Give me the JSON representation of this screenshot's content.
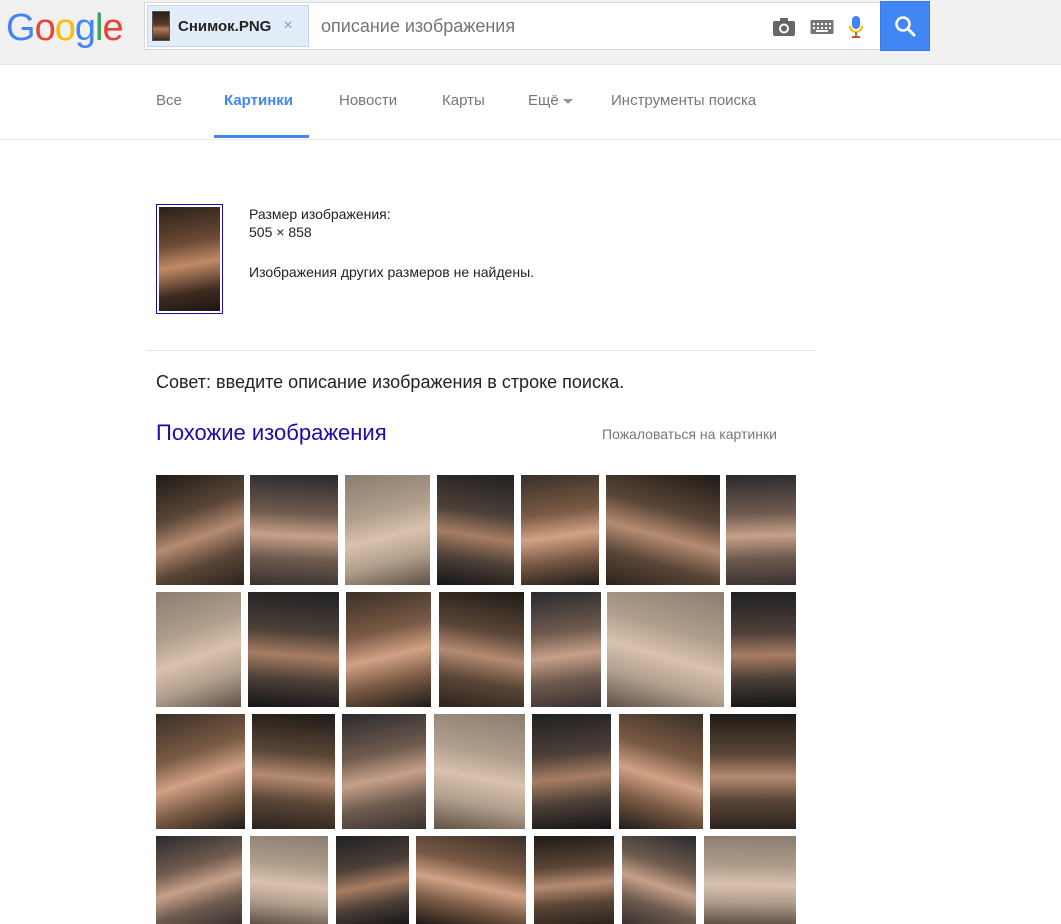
{
  "logo": {
    "letters": [
      "G",
      "o",
      "o",
      "g",
      "l",
      "e"
    ],
    "colors": [
      "#4285f4",
      "#ea4335",
      "#fbbc05",
      "#4285f4",
      "#34a853",
      "#ea4335"
    ]
  },
  "search": {
    "chip_label": "Снимок.PNG",
    "close_symbol": "×",
    "placeholder": "описание изображения"
  },
  "nav": {
    "items": [
      {
        "label": "Все"
      },
      {
        "label": "Картинки"
      },
      {
        "label": "Новости"
      },
      {
        "label": "Карты"
      },
      {
        "label": "Ещё"
      },
      {
        "label": "Инструменты поиска"
      }
    ],
    "active": "Картинки"
  },
  "image_info": {
    "size_label": "Размер изображения:",
    "size_value": "505 × 858",
    "other_sizes": "Изображения других размеров не найдены."
  },
  "tip": "Совет: введите описание изображения в строке поиска.",
  "similar": {
    "title": "Похожие изображения",
    "report_link": "Пожаловаться на картинки"
  },
  "colors": {
    "accent": "#4285f4",
    "link": "#1a0dab"
  }
}
